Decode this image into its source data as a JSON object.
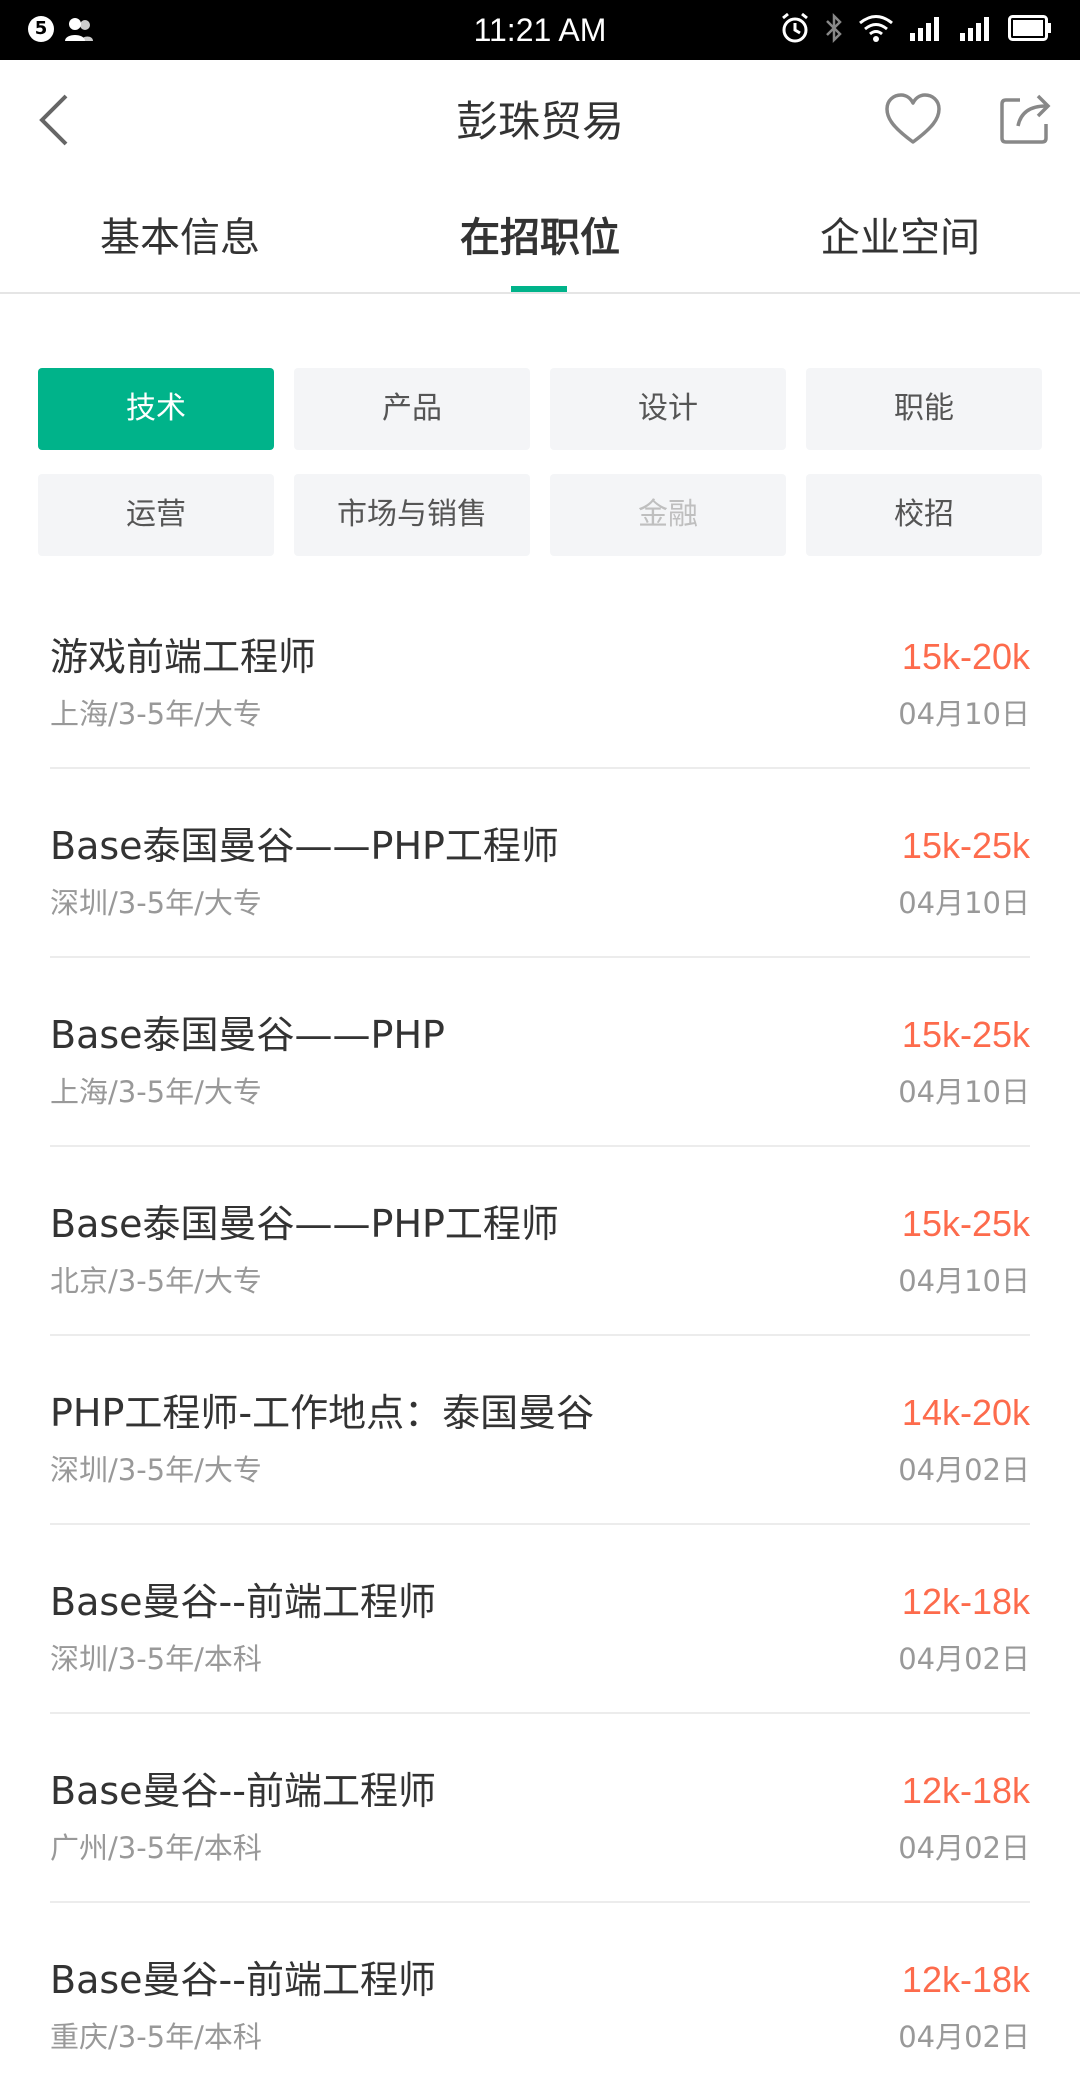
{
  "status_bar": {
    "notification_count": "5",
    "time": "11:21 AM",
    "icons": [
      "user-icon",
      "alarm-icon",
      "bluetooth-icon",
      "wifi-icon",
      "signal-icon",
      "signal-2-icon",
      "battery-icon"
    ]
  },
  "header": {
    "title": "彭珠贸易",
    "icons": [
      "back-icon",
      "heart-icon",
      "share-icon"
    ]
  },
  "tabs": [
    {
      "label": "基本信息",
      "active": false
    },
    {
      "label": "在招职位",
      "active": true
    },
    {
      "label": "企业空间",
      "active": false
    }
  ],
  "categories": [
    {
      "label": "技术",
      "state": "active"
    },
    {
      "label": "产品",
      "state": "normal"
    },
    {
      "label": "设计",
      "state": "normal"
    },
    {
      "label": "职能",
      "state": "normal"
    },
    {
      "label": "运营",
      "state": "normal"
    },
    {
      "label": "市场与销售",
      "state": "normal"
    },
    {
      "label": "金融",
      "state": "disabled"
    },
    {
      "label": "校招",
      "state": "normal"
    }
  ],
  "jobs": [
    {
      "title": "游戏前端工程师",
      "meta": "上海/3-5年/大专",
      "salary": "15k-20k",
      "date": "04月10日"
    },
    {
      "title": "Base泰国曼谷——PHP工程师",
      "meta": "深圳/3-5年/大专",
      "salary": "15k-25k",
      "date": "04月10日"
    },
    {
      "title": "Base泰国曼谷——PHP",
      "meta": "上海/3-5年/大专",
      "salary": "15k-25k",
      "date": "04月10日"
    },
    {
      "title": "Base泰国曼谷——PHP工程师",
      "meta": "北京/3-5年/大专",
      "salary": "15k-25k",
      "date": "04月10日"
    },
    {
      "title": "PHP工程师-工作地点：泰国曼谷",
      "meta": "深圳/3-5年/大专",
      "salary": "14k-20k",
      "date": "04月02日"
    },
    {
      "title": "Base曼谷--前端工程师",
      "meta": "深圳/3-5年/本科",
      "salary": "12k-18k",
      "date": "04月02日"
    },
    {
      "title": "Base曼谷--前端工程师",
      "meta": "广州/3-5年/本科",
      "salary": "12k-18k",
      "date": "04月02日"
    },
    {
      "title": "Base曼谷--前端工程师",
      "meta": "重庆/3-5年/本科",
      "salary": "12k-18k",
      "date": "04月02日"
    }
  ],
  "colors": {
    "accent": "#00b38a",
    "salary": "#fd6b4c",
    "chip_bg": "#f4f5f7",
    "meta_text": "#999999"
  }
}
